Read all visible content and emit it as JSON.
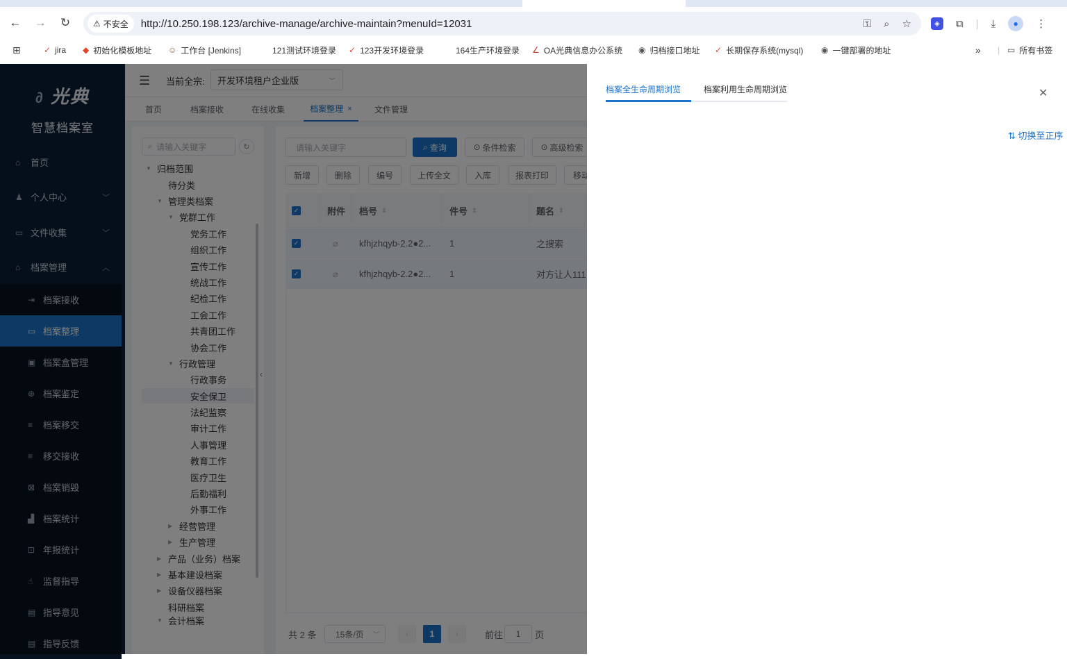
{
  "browser": {
    "security_label": "不安全",
    "url": "http://10.250.198.123/archive-manage/archive-maintain?menuId=12031",
    "bookmarks": [
      "jira",
      "初始化模板地址",
      "工作台 [Jenkins]",
      "121测试环境登录",
      "123开发环境登录",
      "164生产环境登录",
      "OA光典信息办公系统",
      "归档接口地址",
      "长期保存系统(mysql)",
      "一键部署的地址"
    ],
    "all_bookmarks": "所有书签",
    "more": "»"
  },
  "sidebar": {
    "logo_text": "光典",
    "logo_sub": "智慧档案室",
    "items": [
      {
        "label": "首页",
        "icon": "home-icon"
      },
      {
        "label": "个人中心",
        "icon": "user-icon"
      },
      {
        "label": "文件收集",
        "icon": "folder-icon"
      },
      {
        "label": "档案管理",
        "icon": "archive-icon"
      }
    ],
    "subitems": [
      {
        "label": "档案接收"
      },
      {
        "label": "档案整理"
      },
      {
        "label": "档案盒管理"
      },
      {
        "label": "档案鉴定"
      },
      {
        "label": "档案移交"
      },
      {
        "label": "移交接收"
      },
      {
        "label": "档案销毁"
      },
      {
        "label": "档案统计"
      },
      {
        "label": "年报统计"
      },
      {
        "label": "监督指导"
      },
      {
        "label": "指导意见"
      },
      {
        "label": "指导反馈"
      }
    ]
  },
  "topbar": {
    "tenant_label": "当前全宗:",
    "tenant_value": "开发环境租户企业版"
  },
  "route_tabs": [
    "首页",
    "档案接收",
    "在线收集",
    "档案整理",
    "文件管理"
  ],
  "tree": {
    "search_placeholder": "请输入关键字",
    "nodes": [
      "归档范围",
      "待分类",
      "管理类档案",
      "党群工作",
      "党务工作",
      "组织工作",
      "宣传工作",
      "统战工作",
      "纪检工作",
      "工会工作",
      "共青团工作",
      "协会工作",
      "行政管理",
      "行政事务",
      "安全保卫",
      "法纪监察",
      "审计工作",
      "人事管理",
      "教育工作",
      "医疗卫生",
      "后勤福利",
      "外事工作",
      "经营管理",
      "生产管理",
      "产品（业务）档案",
      "基本建设档案",
      "设备仪器档案",
      "科研档案",
      "会计档案"
    ]
  },
  "table": {
    "search_placeholder": "请输入关键字",
    "query_btn": "查询",
    "cond_search_btn": "条件检索",
    "adv_search_btn": "高级检索",
    "actions": [
      "新增",
      "删除",
      "编号",
      "上传全文",
      "入库",
      "报表打印",
      "移动"
    ],
    "columns": [
      "附件",
      "档号",
      "件号",
      "题名"
    ],
    "rows": [
      {
        "code": "kfhjzhqyb-2.2●2...",
        "num": "1",
        "title": "之搜索"
      },
      {
        "code": "kfhjzhqyb-2.2●2...",
        "num": "1",
        "title": "对方让人111"
      }
    ],
    "total": "共 2 条",
    "page_size": "15条/页",
    "current_page": "1",
    "goto_label": "前往",
    "goto_value": "1",
    "page_unit": "页"
  },
  "drawer": {
    "tabs": [
      "档案全生命周期浏览",
      "档案利用生命周期浏览"
    ],
    "sort_toggle": "切换至正序"
  },
  "colors": {
    "accent": "#1d72c9",
    "sidebar_bg": "#0b1e36"
  }
}
